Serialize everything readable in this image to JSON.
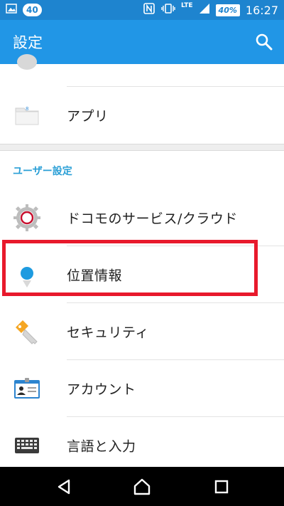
{
  "status_bar": {
    "notification_count": "40",
    "network": "LTE",
    "battery": "40%",
    "time": "16:27"
  },
  "action_bar": {
    "title": "設定"
  },
  "list": {
    "first_item": {
      "label": "アプリ"
    },
    "section_title": "ユーザー設定",
    "items": [
      {
        "label": "ドコモのサービス/クラウド"
      },
      {
        "label": "位置情報"
      },
      {
        "label": "セキュリティ"
      },
      {
        "label": "アカウント"
      },
      {
        "label": "言語と入力"
      }
    ]
  },
  "colors": {
    "status_bar": "#1e84cf",
    "action_bar": "#2196e6",
    "section_title": "#2a9fd6",
    "highlight": "#e8192c"
  }
}
